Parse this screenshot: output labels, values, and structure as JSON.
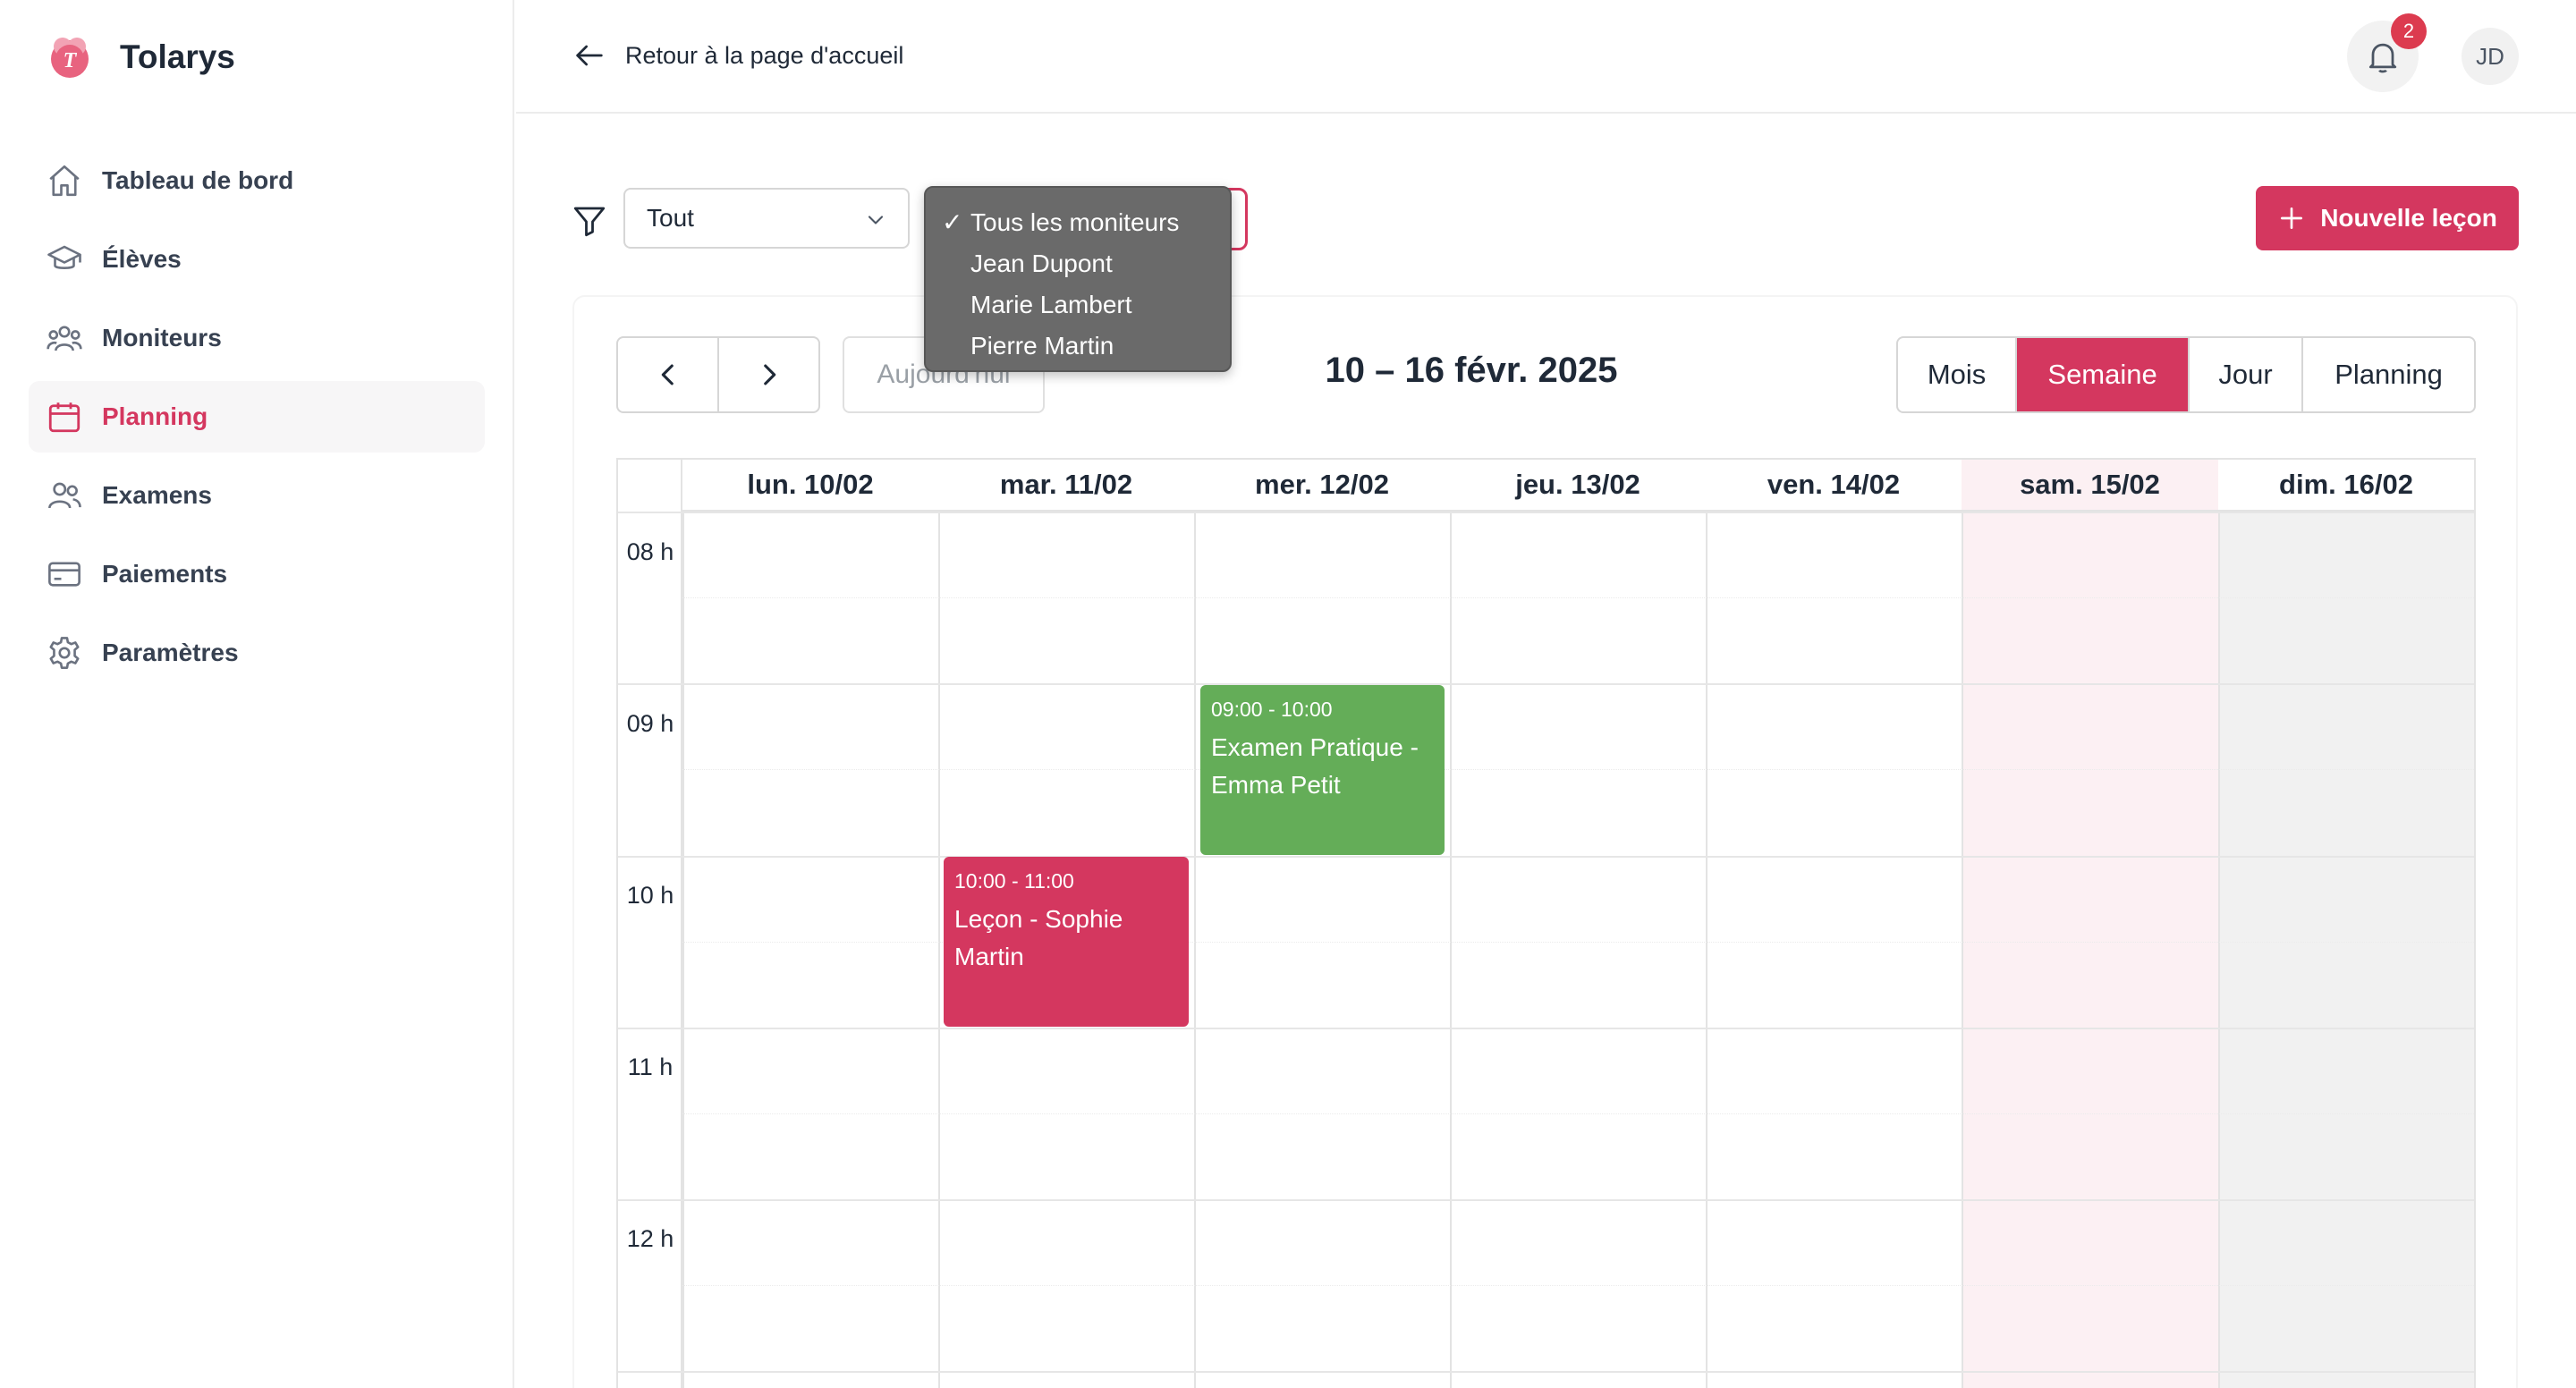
{
  "brand": {
    "name": "Tolarys",
    "logo_letter": "T"
  },
  "sidebar": {
    "items": [
      {
        "label": "Tableau de bord",
        "icon": "home-icon"
      },
      {
        "label": "Élèves",
        "icon": "graduation-cap-icon"
      },
      {
        "label": "Moniteurs",
        "icon": "users-group-icon"
      },
      {
        "label": "Planning",
        "icon": "calendar-icon",
        "active": true
      },
      {
        "label": "Examens",
        "icon": "users-icon"
      },
      {
        "label": "Paiements",
        "icon": "credit-card-icon"
      },
      {
        "label": "Paramètres",
        "icon": "gear-icon"
      }
    ]
  },
  "header": {
    "back_label": "Retour à la page d'accueil",
    "notifications_count": "2",
    "avatar_initials": "JD"
  },
  "filters": {
    "type_value": "Tout",
    "monitor_options": [
      "Tous les moniteurs",
      "Jean Dupont",
      "Marie Lambert",
      "Pierre Martin"
    ],
    "monitor_selected": "Tous les moniteurs",
    "checkmark": "✓"
  },
  "actions": {
    "new_lesson_label": "Nouvelle leçon"
  },
  "calendar": {
    "today_label": "Aujourd'hui",
    "range_title": "10 – 16 févr. 2025",
    "views": [
      "Mois",
      "Semaine",
      "Jour",
      "Planning"
    ],
    "active_view": "Semaine",
    "days": [
      "lun. 10/02",
      "mar. 11/02",
      "mer. 12/02",
      "jeu. 13/02",
      "ven. 14/02",
      "sam. 15/02",
      "dim. 16/02"
    ],
    "hours": [
      "08 h",
      "09 h",
      "10 h",
      "11 h",
      "12 h"
    ],
    "events": [
      {
        "time": "09:00 - 10:00",
        "title": "Examen Pratique - Emma Petit",
        "day": "mer. 12/02",
        "color": "#64ad58"
      },
      {
        "time": "10:00 - 11:00",
        "title": "Leçon - Sophie Martin",
        "day": "mar. 11/02",
        "color": "#d4375f"
      }
    ]
  },
  "colors": {
    "accent": "#d4375f",
    "exam": "#64ad58",
    "badge": "#dc3b4f",
    "saturday_bg": "#fcf0f3",
    "sunday_bg": "#f1f1f1"
  }
}
